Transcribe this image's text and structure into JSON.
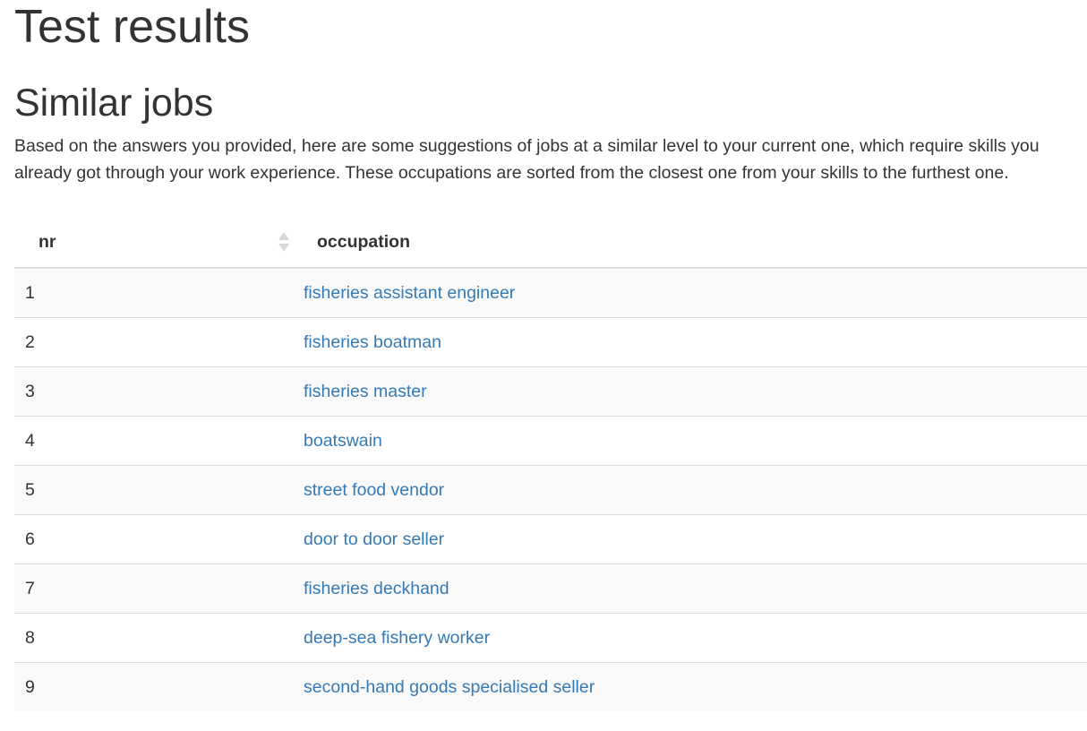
{
  "page": {
    "title": "Test results"
  },
  "section": {
    "title": "Similar jobs",
    "intro": "Based on the answers you provided, here are some suggestions of jobs at a similar level to your current one, which require skills you already got through your work experience. These occupations are sorted from the closest one from your skills to the furthest one."
  },
  "table": {
    "columns": [
      "nr",
      "occupation"
    ],
    "rows": [
      {
        "nr": "1",
        "occupation": "fisheries assistant engineer"
      },
      {
        "nr": "2",
        "occupation": "fisheries boatman"
      },
      {
        "nr": "3",
        "occupation": "fisheries master"
      },
      {
        "nr": "4",
        "occupation": "boatswain"
      },
      {
        "nr": "5",
        "occupation": "street food vendor"
      },
      {
        "nr": "6",
        "occupation": "door to door seller"
      },
      {
        "nr": "7",
        "occupation": "fisheries deckhand"
      },
      {
        "nr": "8",
        "occupation": "deep-sea fishery worker"
      },
      {
        "nr": "9",
        "occupation": "second-hand goods specialised seller"
      }
    ]
  },
  "colors": {
    "text": "#333333",
    "link": "#337ab7",
    "stripe": "#f9f9f9",
    "border": "#dddddd"
  },
  "icons": {
    "sort": "sort-both-icon"
  }
}
